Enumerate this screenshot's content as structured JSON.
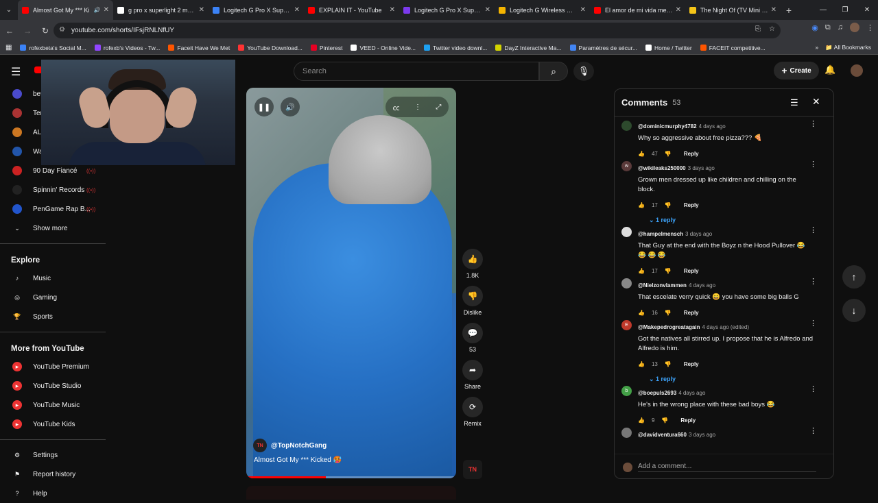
{
  "browser": {
    "tabs": [
      {
        "title": "Almost Got My *** Ki",
        "color": "#ff0000",
        "active": true
      },
      {
        "title": "g pro x superlight 2 mano",
        "color": "#ffffff"
      },
      {
        "title": "Logitech G Pro X Superlig",
        "color": "#3b82f6"
      },
      {
        "title": "EXPLAIN IT - YouTube",
        "color": "#ff0000"
      },
      {
        "title": "Logitech G Pro X Superlig",
        "color": "#7c3aed"
      },
      {
        "title": "Logitech G Wireless Gam",
        "color": "#f4b400"
      },
      {
        "title": "El amor de mi vida me in",
        "color": "#ff0000"
      },
      {
        "title": "The Night Of (TV Mini Se",
        "color": "#f5c518"
      }
    ],
    "url": "youtube.com/shorts/IFsjRNLNfUY",
    "bookmarks": [
      {
        "label": "rofexbeta's Social M...",
        "color": "#3b82f6"
      },
      {
        "label": "rofexb's Videos - Tw...",
        "color": "#9146ff"
      },
      {
        "label": "Faceit Have We Met",
        "color": "#ff5500"
      },
      {
        "label": "YouTube Download...",
        "color": "#ff3333"
      },
      {
        "label": "Pinterest",
        "color": "#e60023"
      },
      {
        "label": "VEED - Online Vide...",
        "color": "#ffffff"
      },
      {
        "label": "Twitter video downl...",
        "color": "#1da1f2"
      },
      {
        "label": "DayZ Interactive Ma...",
        "color": "#d4d400"
      },
      {
        "label": "Paramètres de sécur...",
        "color": "#4285f4"
      },
      {
        "label": "Home / Twitter",
        "color": "#ffffff"
      },
      {
        "label": "FACEIT competitive...",
        "color": "#ff5500"
      }
    ],
    "all_bookmarks": "All Bookmarks"
  },
  "youtube": {
    "search_placeholder": "Search",
    "create_label": "Create",
    "sidebar": {
      "subs": [
        {
          "label": "bet",
          "color": "#4b4bcc"
        },
        {
          "label": "Ter",
          "color": "#aa3333"
        },
        {
          "label": "AL",
          "color": "#cc7722"
        },
        {
          "label": "Wa",
          "color": "#2255aa"
        },
        {
          "label": "90 Day Fiancé",
          "color": "#cc2222"
        },
        {
          "label": "Spinnin' Records",
          "color": "#222222"
        },
        {
          "label": "PenGame Rap B...",
          "color": "#2255cc"
        }
      ],
      "show_more": "Show more",
      "explore_head": "Explore",
      "explore": [
        {
          "label": "Music",
          "icon": "music-note-icon"
        },
        {
          "label": "Gaming",
          "icon": "gaming-icon"
        },
        {
          "label": "Sports",
          "icon": "trophy-icon"
        }
      ],
      "more_head": "More from YouTube",
      "more": [
        "YouTube Premium",
        "YouTube Studio",
        "YouTube Music",
        "YouTube Kids"
      ],
      "settings": "Settings",
      "report_history": "Report history",
      "help": "Help"
    },
    "short": {
      "channel": "@TopNotchGang",
      "title": "Almost Got My *** Kicked 🥵",
      "progress": 0.38,
      "likes": "1.8K",
      "dislike": "Dislike",
      "comments": "53",
      "share": "Share",
      "remix": "Remix"
    },
    "comments_panel": {
      "title": "Comments",
      "count": "53",
      "add_placeholder": "Add a comment...",
      "items": [
        {
          "user": "@dominicmurphy4782",
          "when": "4 days ago",
          "text": "Why so aggressive about free pizza??? 🍕",
          "likes": "47",
          "color": "#2d4a2d",
          "initial": "",
          "replies": ""
        },
        {
          "user": "@wikileaks250000",
          "when": "3 days ago",
          "text": "Grown men dressed up like children and chilling on the block.",
          "likes": "17",
          "color": "#5a3a3a",
          "initial": "w",
          "replies": "1 reply"
        },
        {
          "user": "@hampelmensch",
          "when": "3 days ago",
          "text": "That Guy at the end with the Boyz n the Hood Pullover 😂 😂 😂 😂",
          "likes": "17",
          "color": "#dddddd",
          "initial": "",
          "replies": ""
        },
        {
          "user": "@Nielzonvlammen",
          "when": "4 days ago",
          "text": "That escelate verry quick 😄   you have some big balls G",
          "likes": "16",
          "color": "#888888",
          "initial": "",
          "replies": ""
        },
        {
          "user": "@Makepedrogreatagain",
          "when": "4 days ago (edited)",
          "text": "Got the natives all stirred up.  I propose that he is Alfredo and Alfredo is him.",
          "likes": "13",
          "color": "#c0392b",
          "initial": "E",
          "replies": "1 reply"
        },
        {
          "user": "@boepuls2693",
          "when": "4 days ago",
          "text": "He's in the wrong place with these bad boys 😂",
          "likes": "9",
          "color": "#43a047",
          "initial": "b",
          "replies": ""
        },
        {
          "user": "@davidventura660",
          "when": "3 days ago",
          "text": "",
          "likes": "",
          "color": "#777777",
          "initial": "",
          "replies": ""
        }
      ]
    }
  }
}
